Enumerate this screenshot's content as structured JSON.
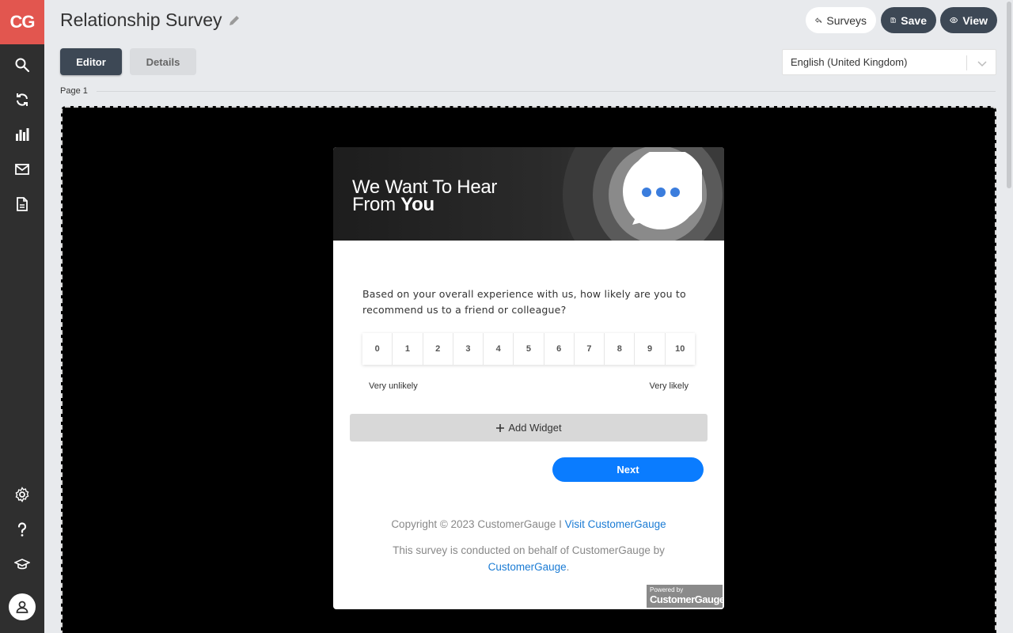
{
  "sidebar": {
    "logo": "CG",
    "items": [
      {
        "name": "search-icon"
      },
      {
        "name": "refresh-icon"
      },
      {
        "name": "bar-chart-icon"
      },
      {
        "name": "mail-icon"
      },
      {
        "name": "document-icon"
      }
    ],
    "bottom_items": [
      {
        "name": "settings-icon"
      },
      {
        "name": "help-icon"
      },
      {
        "name": "graduation-cap-icon"
      },
      {
        "name": "user-icon"
      }
    ]
  },
  "header": {
    "title": "Relationship Survey",
    "surveys_label": "Surveys",
    "save_label": "Save",
    "view_label": "View"
  },
  "tabs": [
    {
      "label": "Editor",
      "active": true
    },
    {
      "label": "Details",
      "active": false
    }
  ],
  "language": {
    "selected": "English (United Kingdom)"
  },
  "page": {
    "label": "Page 1"
  },
  "survey": {
    "banner": {
      "line1": "We Want To Hear",
      "line2_prefix": "From ",
      "line2_bold": "You"
    },
    "question": "Based on your overall experience with us, how likely are you to recommend us to a friend or colleague?",
    "scale": [
      "0",
      "1",
      "2",
      "3",
      "4",
      "5",
      "6",
      "7",
      "8",
      "9",
      "10"
    ],
    "low_label": "Very unlikely",
    "high_label": "Very likely",
    "add_widget_label": "Add Widget",
    "next_label": "Next",
    "footer": {
      "copyright": "Copyright © 2023 CustomerGauge I ",
      "visit_link": "Visit CustomerGauge",
      "conducted_text": "This survey is conducted on behalf of CustomerGauge by",
      "conducted_link": "CustomerGauge",
      "conducted_end": "."
    },
    "powered_small": "Powered by",
    "powered_big": "CustomerGauge"
  },
  "colors": {
    "logo_bg": "#e2564f",
    "sidebar_bg": "#2f2f2f",
    "primary_dark": "#3d4855",
    "next_button": "#0a7cff",
    "link": "#1a7bd4",
    "chat_dots": "#3b7ddd"
  }
}
